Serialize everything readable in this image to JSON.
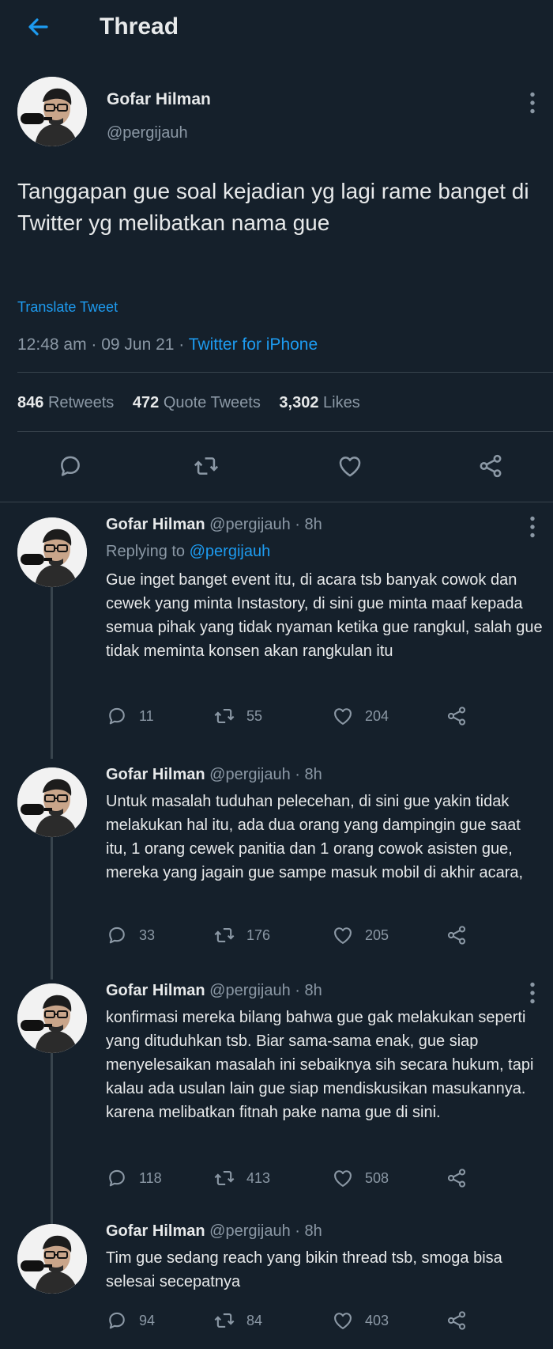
{
  "header": {
    "title": "Thread"
  },
  "main_tweet": {
    "name": "Gofar Hilman",
    "handle": "@pergijauh",
    "text": "Tanggapan gue soal kejadian yg lagi rame banget di Twitter yg melibatkan nama gue",
    "translate": "Translate Tweet",
    "timestamp": "12:48 am · 09 Jun 21 · ",
    "source": "Twitter for iPhone",
    "retweets_count": "846",
    "retweets_label": "Retweets",
    "quotes_count": "472",
    "quotes_label": "Quote Tweets",
    "likes_count": "3,302",
    "likes_label": "Likes"
  },
  "replies": [
    {
      "name": "Gofar Hilman",
      "handle": "@pergijauh · 8h",
      "replying_prefix": "Replying to ",
      "replying_to": "@pergijauh",
      "text": "Gue inget banget event itu, di acara tsb banyak cowok dan cewek yang minta Instastory, di sini gue minta maaf kepada semua pihak yang tidak nyaman ketika gue rangkul, salah gue tidak meminta konsen akan rangkulan itu",
      "replies": "11",
      "retweets": "55",
      "likes": "204"
    },
    {
      "name": "Gofar Hilman",
      "handle": "@pergijauh · 8h",
      "text": "Untuk masalah tuduhan pelecehan, di sini gue yakin tidak melakukan hal itu, ada dua orang yang dampingin gue saat itu, 1 orang cewek panitia dan 1 orang cowok asisten gue,  mereka yang jagain gue sampe masuk mobil di akhir acara,",
      "replies": "33",
      "retweets": "176",
      "likes": "205"
    },
    {
      "name": "Gofar Hilman",
      "handle": "@pergijauh · 8h",
      "text": "konfirmasi mereka bilang bahwa gue gak melakukan seperti yang dituduhkan tsb. Biar sama-sama enak, gue siap menyelesaikan masalah ini sebaiknya sih secara hukum, tapi kalau ada usulan lain gue siap mendiskusikan masukannya. karena melibatkan fitnah pake nama gue di sini.",
      "replies": "118",
      "retweets": "413",
      "likes": "508"
    },
    {
      "name": "Gofar Hilman",
      "handle": "@pergijauh · 8h",
      "text": "Tim gue sedang reach yang bikin thread tsb, smoga bisa selesai secepatnya",
      "replies": "94",
      "retweets": "84",
      "likes": "403"
    }
  ],
  "colors": {
    "background": "#15202b",
    "accent": "#1d9bf0",
    "secondary_text": "#8b98a5",
    "divider": "#38444d"
  },
  "icons": [
    "back-arrow-icon",
    "more-icon",
    "reply-icon",
    "retweet-icon",
    "like-icon",
    "share-icon"
  ]
}
